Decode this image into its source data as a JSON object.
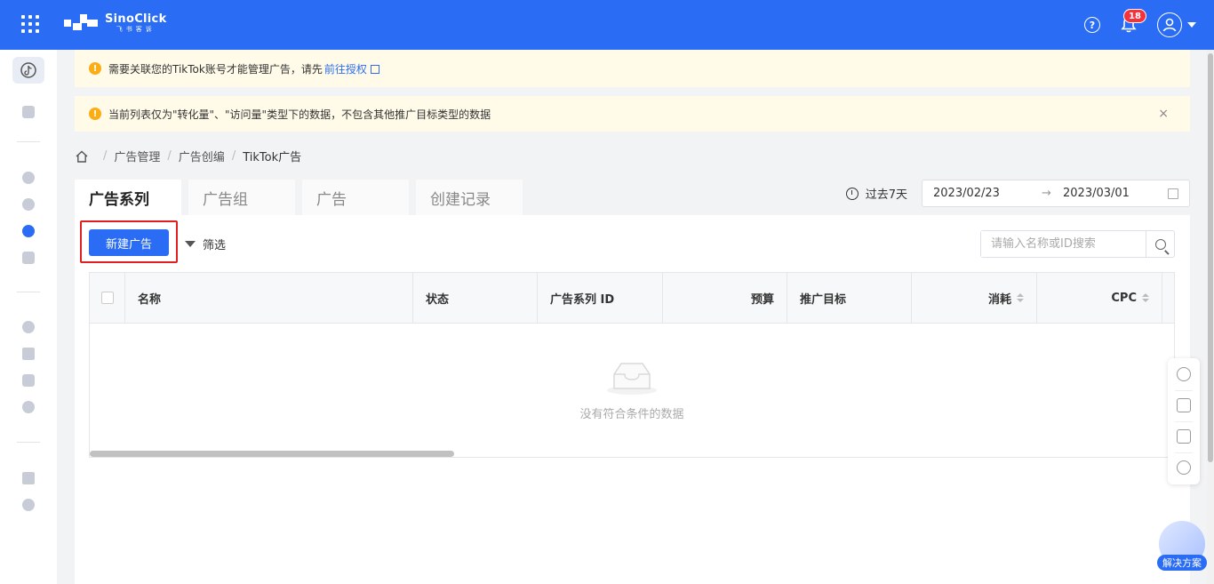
{
  "topbar": {
    "brand_name": "SinoClick",
    "brand_sub": "飞书客诉",
    "notification_count": "18",
    "help_glyph": "?",
    "bg_color": "#2a6df4"
  },
  "banners": {
    "link_notice": "需要关联您的TikTok账号才能管理广告，请先",
    "link_action": "前往授权",
    "data_notice": "当前列表仅为\"转化量\"、\"访问量\"类型下的数据，不包含其他推广目标类型的数据",
    "warn_glyph": "!",
    "close_glyph": "×"
  },
  "breadcrumb": {
    "items": [
      "广告管理",
      "广告创编",
      "TikTok广告"
    ],
    "separator": "/"
  },
  "tabs": [
    "广告系列",
    "广告组",
    "广告",
    "创建记录"
  ],
  "date_filter": {
    "preset": "过去7天",
    "start": "2023/02/23",
    "arrow": "→",
    "end": "2023/03/01"
  },
  "toolbar": {
    "create_label": "新建广告",
    "filter_label": "筛选",
    "search_placeholder": "请输入名称或ID搜索"
  },
  "table": {
    "columns": [
      "名称",
      "状态",
      "广告系列 ID",
      "预算",
      "推广目标",
      "消耗",
      "CPC"
    ],
    "empty_text": "没有符合条件的数据"
  },
  "solution": {
    "label": "解决方案"
  }
}
